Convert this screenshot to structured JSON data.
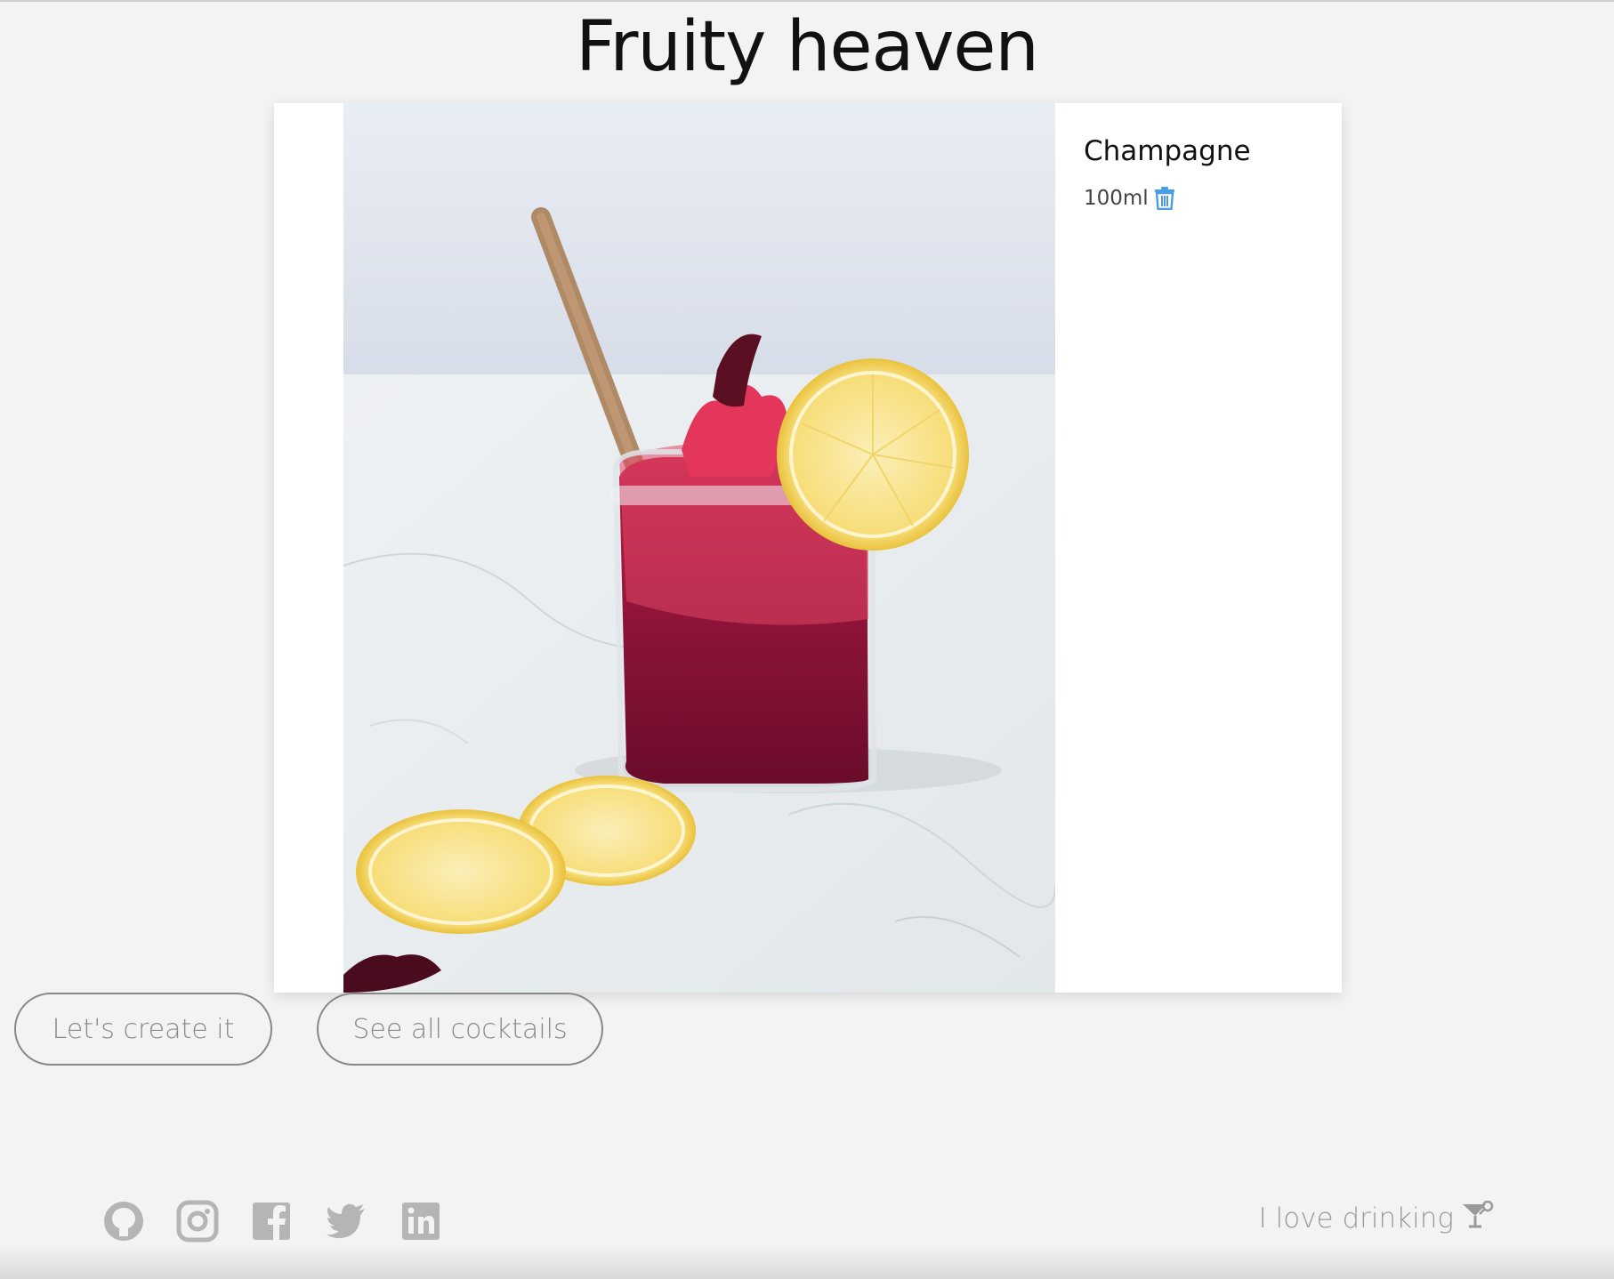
{
  "page": {
    "title": "Fruity heaven"
  },
  "cocktail": {
    "image_alt": "cocktail photo",
    "ingredients": [
      {
        "name": "Champagne",
        "amount": "100ml"
      }
    ]
  },
  "buttons": {
    "create_label": "Let's create it",
    "all_label": "See all cocktails"
  },
  "footer": {
    "social": [
      "github-icon",
      "instagram-icon",
      "facebook-icon",
      "twitter-icon",
      "linkedin-icon"
    ],
    "tagline": "I love drinking"
  },
  "colors": {
    "background": "#f3f3f3",
    "accent": "#4a9de0",
    "icon_gray": "#b5b5b5"
  }
}
